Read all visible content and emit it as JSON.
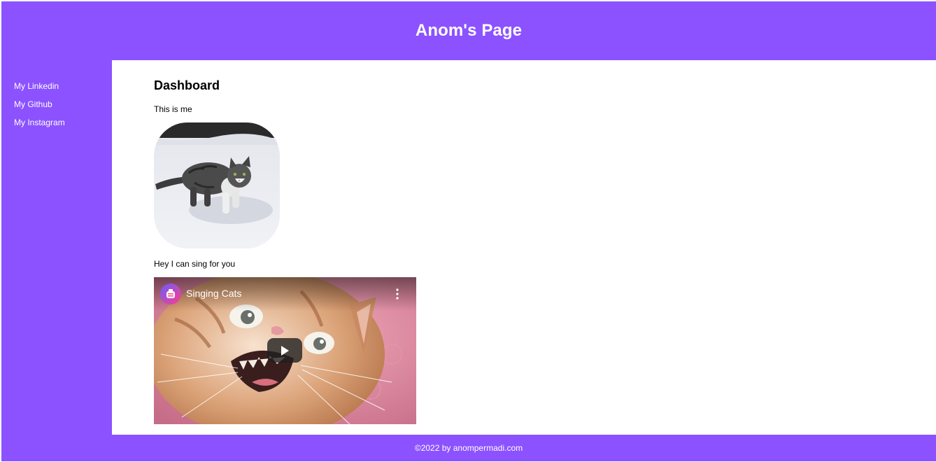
{
  "header": {
    "title": "Anom's Page"
  },
  "sidebar": {
    "links": [
      {
        "label": "My Linkedin"
      },
      {
        "label": "My Github"
      },
      {
        "label": "My Instagram"
      }
    ]
  },
  "main": {
    "heading": "Dashboard",
    "photo_caption": "This is me",
    "video_caption": "Hey I can sing for you",
    "video": {
      "title": "Singing Cats",
      "icons": {
        "channel": "channel-avatar-icon",
        "menu": "more-options-icon",
        "play": "play-icon"
      }
    }
  },
  "footer": {
    "text": "©2022 by anompermadi.com"
  },
  "colors": {
    "brand": "#8c52ff",
    "text_on_brand": "#ffffff",
    "content_bg": "#ffffff"
  }
}
